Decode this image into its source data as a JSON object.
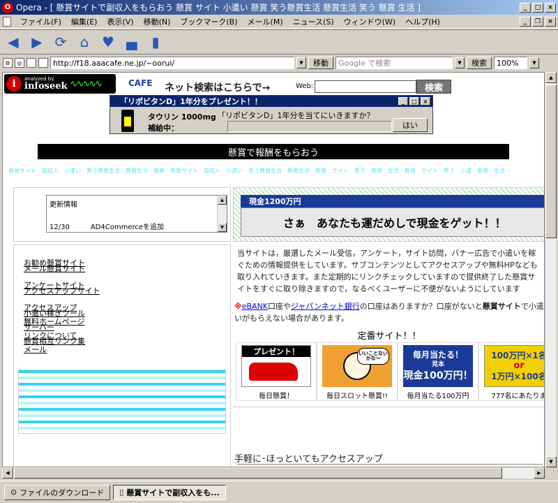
{
  "window": {
    "title": "Opera - [ 懸賞サイトで副収入をもらおう 懸賞 サイト 小遣い 懸賞 笑う懸賞生活 懸賞生活 笑う 懸賞 生活 ]",
    "app_icon": "O"
  },
  "menu": {
    "items": [
      "ファイル(F)",
      "編集(E)",
      "表示(V)",
      "移動(N)",
      "ブックマーク(B)",
      "メール(M)",
      "ニュース(S)",
      "ウィンドウ(W)",
      "ヘルプ(H)"
    ]
  },
  "toolbar": {
    "icons": [
      "back-icon",
      "forward-icon",
      "reload-icon",
      "home-icon",
      "hotlist-icon",
      "print-icon",
      "new-page-icon"
    ]
  },
  "address": {
    "url": "http://f18.aaacafe.ne.jp/~oorui/",
    "go_label": "移動",
    "search_placeholder": "Google で検索",
    "search_label": "検索",
    "zoom": "100%"
  },
  "page": {
    "infoseek": {
      "analyzed_by": "analyzed by",
      "brand": "infoseek",
      "cafe": "CAFE",
      "net_search": "ネット検索はこちらで→",
      "web_label": "Web:",
      "search_button": "検索"
    },
    "popup": {
      "title": "「リポビタンD」1年分をプレゼント！！",
      "taurin": "タウリン 1000mg",
      "supply": "補給中：",
      "question": "「リポビタンD」1年分を当てにいきますか？",
      "yes": "はい"
    },
    "banner": "懸賞で報酬をもらおう",
    "keywords": "懸賞サイト　副収入　小遣い　笑う懸賞生活　懸賞生活　懸賞　懸賞サイト　副収入　小遣い　笑う懸賞生活　懸賞生活　懸賞　サイト　笑う　懸賞　生活　懸賞　サイト　笑う　小遣　懸賞　生活",
    "updates": {
      "heading": "更新情報",
      "rows": [
        {
          "date": "12/30",
          "text": "AD4Commerceを追加"
        }
      ]
    },
    "ad": {
      "heading": "現金1200万円",
      "body": "さぁ　あなたも運だめしで現金をゲット！！"
    },
    "left_menu": [
      {
        "label": "お勧め懸賞サイト",
        "overlap": "メール懸賞サイト"
      },
      {
        "label": "アンケートサイト",
        "overlap": "アクセスアップサイト"
      },
      {
        "label": "アクセスアップ",
        "overlap": "小遣い稼ぎツール"
      },
      {
        "label": "無料ホームページ",
        "overlap": "サーバー"
      },
      {
        "label": "リンクについて",
        "overlap": "懸賞相互リンク集"
      },
      {
        "label": "メール",
        "overlap": ""
      }
    ],
    "intro": "当サイトは，厳選したメール受信，アンケート，サイト訪問，バナー広告で小遣いを稼ぐための情報提供をしています。サブコンテンツとしてアクセスアップや無料HPなども取り入れていきます。また定期的にリンクチェックしていますので提供終了した懸賞サイトをすぐに取り除きますので，なるべくユーザーに不便がないようにしています",
    "notice": {
      "star": "※",
      "bank1": "eBANK",
      "mid1": "口座や",
      "bank2": "ジャパンネット銀行",
      "mid2": "の口座はありますか？口座がないと",
      "bold": "懸賞サイト",
      "tail": "で小遣いがもらえない場合があります。"
    },
    "teiban": "定番サイト！！",
    "sites": [
      {
        "name": "毎日懸賞！",
        "thumb_text": "プレゼント！",
        "icon": "car-image"
      },
      {
        "name": "毎日スロット懸賞!!",
        "thumb_text": "いいことないかな～",
        "icon": "face-image"
      },
      {
        "name": "毎月当たる100万円",
        "thumb_text": "毎月当たる！",
        "thumb_sample": "見本",
        "thumb_big": "現金100万円！",
        "icon": "cash-image"
      },
      {
        "name": "777名にあたりま",
        "thumb_text": "100万円×1名",
        "thumb_or": "or",
        "thumb_big": "1万円×100名",
        "icon": "prize-image"
      }
    ],
    "tegaru": "手軽に･ほっといてもアクセスアップ"
  },
  "statusbar": {
    "tabs": [
      {
        "label": "ファイルのダウンロード",
        "active": false
      },
      {
        "label": "懸賞サイトで副収入をも...",
        "active": true
      }
    ]
  },
  "colors": {
    "title_gradient_start": "#0a246a",
    "chrome": "#d4d0c8",
    "keyword_cyan": "#66e0f0",
    "ad_blue": "#1a3a9a"
  }
}
